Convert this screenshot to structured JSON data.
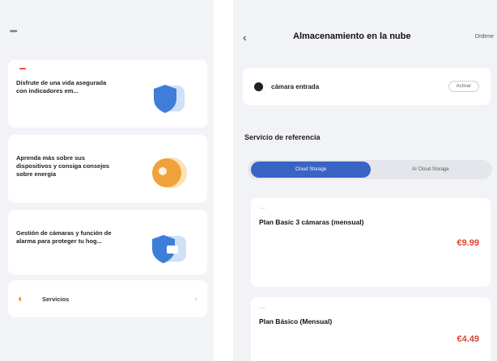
{
  "left_screen": {
    "status_time": "",
    "status_right": "",
    "cards": [
      {
        "tag": "",
        "has_new_badge": true,
        "new_badge": "",
        "title": "Disfrute de una vida asegurada con indicadores em...",
        "icon": "shield-illustration",
        "accent": "#3f7ed8"
      },
      {
        "tag": "",
        "has_new_badge": false,
        "title": "Aprenda más sobre sus dispositivos y consiga consejos sobre energía",
        "icon": "bulb-illustration",
        "accent": "#f0a23a"
      },
      {
        "tag": "",
        "has_new_badge": false,
        "title": "Gestión de cámaras y función de alarma para proteger tu hog...",
        "icon": "camera-illustration",
        "accent": "#3f7ed8"
      }
    ],
    "services": {
      "label": "Servicios",
      "icon": "services-icon"
    }
  },
  "right_screen": {
    "status_time": "",
    "status_right": "",
    "nav": {
      "back_icon": "back-arrow-icon",
      "title": "Almacenamiento en la nube",
      "order": "Ordene"
    },
    "camera": {
      "name": "cámara entrada",
      "button": "Activar"
    },
    "section_title": "Servicio de referencia",
    "tabs": [
      "Cloud Storage",
      "AI Cloud Storage"
    ],
    "active_tab": 0,
    "plans": [
      {
        "badge": "",
        "name": "Plan Basic 3 cámaras (mensual)",
        "desc": "",
        "price": "€9.99",
        "note": ""
      },
      {
        "badge": "",
        "name": "Plan Básico (Mensual)",
        "desc": "",
        "price": "€4.49",
        "note": ""
      }
    ],
    "colors": {
      "accent": "#3a63c6",
      "price": "#e0422f"
    }
  }
}
